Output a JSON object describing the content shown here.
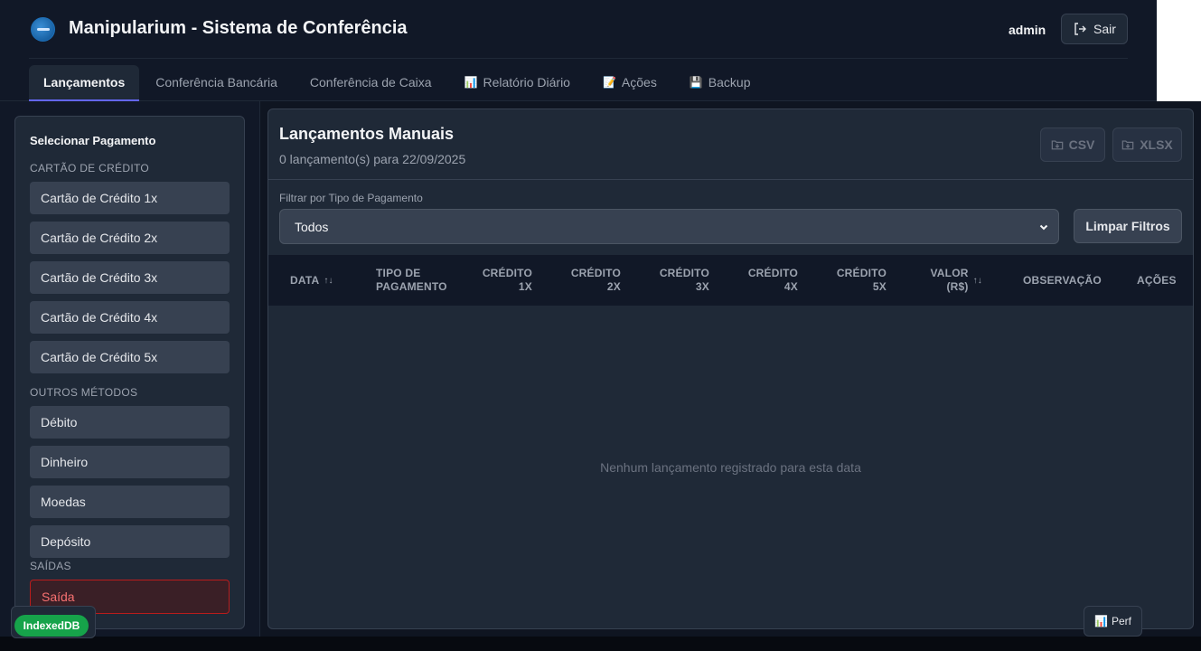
{
  "header": {
    "title": "Manipularium - Sistema de Conferência",
    "user": "admin",
    "logout_label": "Sair"
  },
  "tabs": [
    {
      "label": "Lançamentos",
      "icon": ""
    },
    {
      "label": "Conferência Bancária",
      "icon": ""
    },
    {
      "label": "Conferência de Caixa",
      "icon": ""
    },
    {
      "label": "Relatório Diário",
      "icon": "📊"
    },
    {
      "label": "Ações",
      "icon": "📝"
    },
    {
      "label": "Backup",
      "icon": "💾"
    }
  ],
  "sidebar": {
    "title": "Selecionar Pagamento",
    "sections": [
      {
        "label": "CARTÃO DE CRÉDITO"
      },
      {
        "label": "OUTROS MÉTODOS"
      },
      {
        "label": "SAÍDAS"
      }
    ],
    "buttons": [
      {
        "label": "Cartão de Crédito 1x"
      },
      {
        "label": "Cartão de Crédito 2x"
      },
      {
        "label": "Cartão de Crédito 3x"
      },
      {
        "label": "Cartão de Crédito 4x"
      },
      {
        "label": "Cartão de Crédito 5x"
      },
      {
        "label": "Débito"
      },
      {
        "label": "Dinheiro"
      },
      {
        "label": "Moedas"
      },
      {
        "label": "Depósito"
      },
      {
        "label": "Saída"
      }
    ]
  },
  "main": {
    "title": "Lançamentos Manuais",
    "subtitle": "0 lançamento(s) para 22/09/2025",
    "export_csv": "CSV",
    "export_xlsx": "XLSX",
    "filter_label": "Filtrar por Tipo de Pagamento",
    "filter_value": "Todos",
    "clear_label": "Limpar Filtros",
    "columns": [
      {
        "line1": "DATA",
        "line2": "",
        "sort": "↑↓"
      },
      {
        "line1": "TIPO DE",
        "line2": "PAGAMENTO",
        "sort": ""
      },
      {
        "line1": "CRÉDITO",
        "line2": "1X",
        "sort": ""
      },
      {
        "line1": "CRÉDITO",
        "line2": "2X",
        "sort": ""
      },
      {
        "line1": "CRÉDITO",
        "line2": "3X",
        "sort": ""
      },
      {
        "line1": "CRÉDITO",
        "line2": "4X",
        "sort": ""
      },
      {
        "line1": "CRÉDITO",
        "line2": "5X",
        "sort": ""
      },
      {
        "line1": "VALOR",
        "line2": "(R$)",
        "sort": "↑↓"
      },
      {
        "line1": "OBSERVAÇÃO",
        "line2": "",
        "sort": ""
      },
      {
        "line1": "AÇÕES",
        "line2": "",
        "sort": ""
      }
    ],
    "empty_message": "Nenhum lançamento registrado para esta data"
  },
  "status": {
    "db_badge": "IndexedDB",
    "perf_label": "Perf",
    "perf_icon": "📊"
  },
  "colors": {
    "accent": "#6366f1",
    "danger": "#f87171",
    "success": "#16a34a"
  }
}
